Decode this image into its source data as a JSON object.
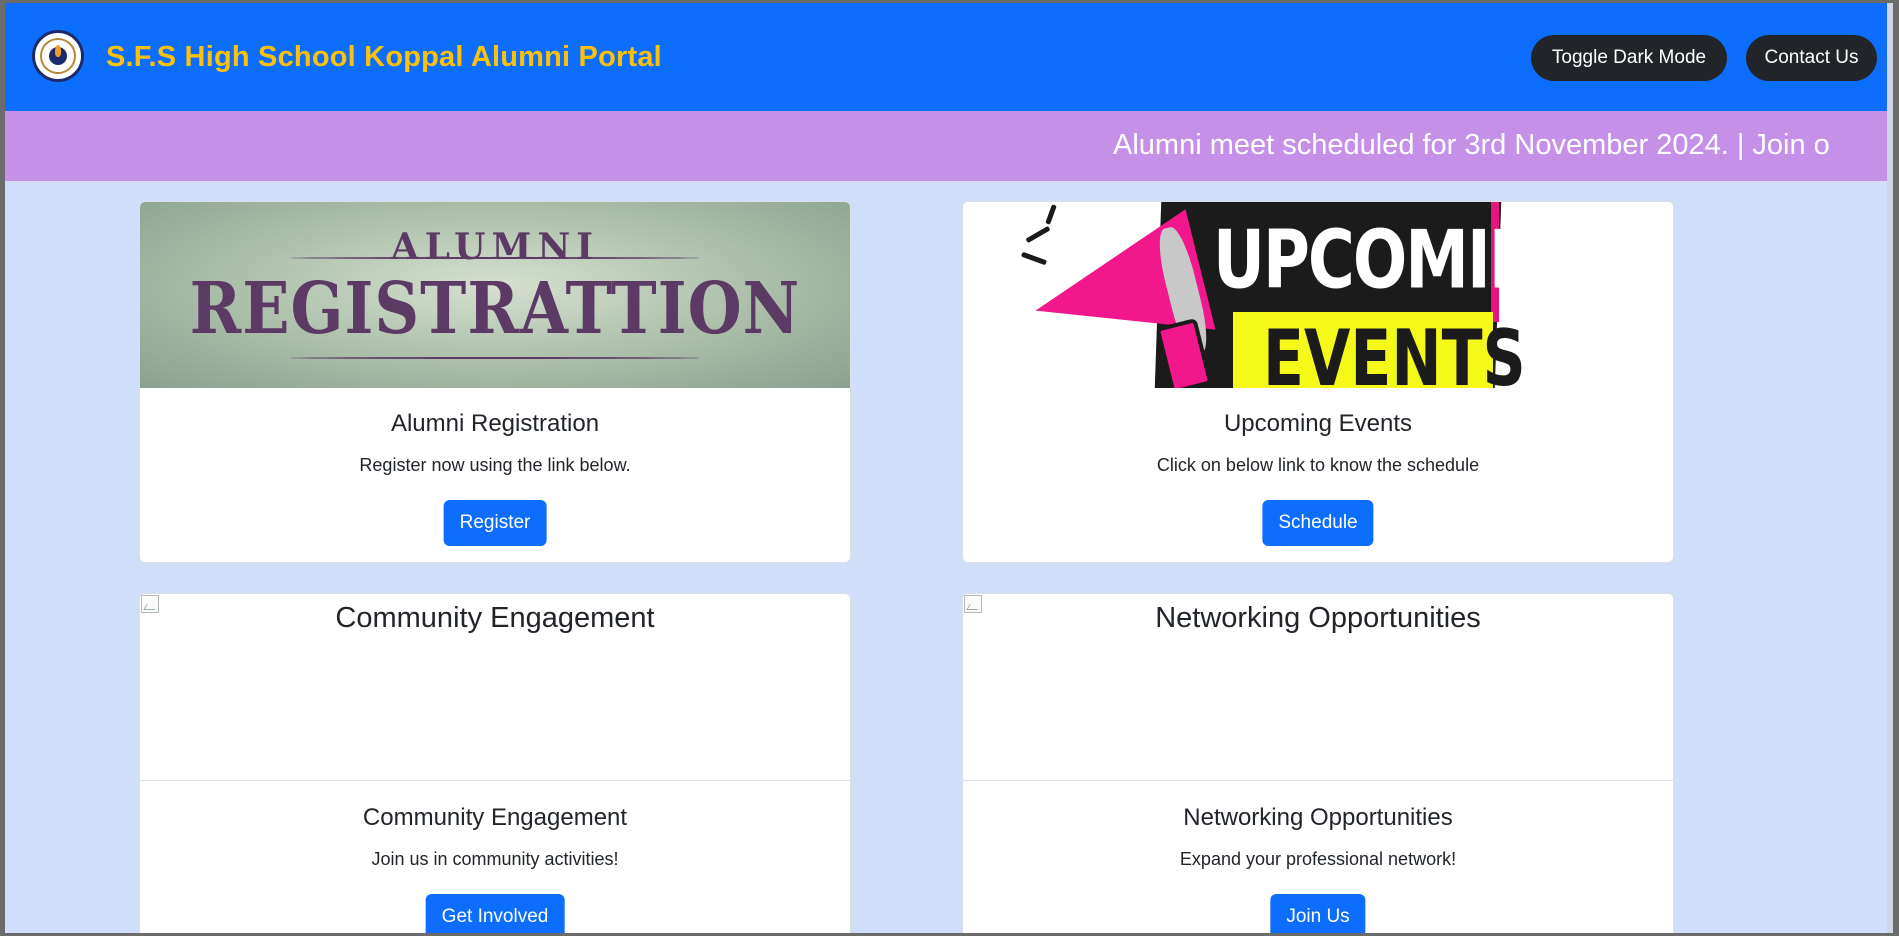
{
  "header": {
    "brand": "S.F.S High School Koppal Alumni Portal",
    "toggle_dark_mode": "Toggle Dark Mode",
    "contact_us": "Contact Us"
  },
  "ticker": {
    "text": "Alumni meet scheduled for 3rd November 2024. | Join o"
  },
  "cards": [
    {
      "image_line1": "ALUMNI",
      "image_line2": "REGISTRATTION",
      "title": "Alumni Registration",
      "text": "Register now using the link below.",
      "button": "Register"
    },
    {
      "image_line1": "UPCOMING",
      "image_line2": "EVENTS",
      "title": "Upcoming Events",
      "text": "Click on below link to know the schedule",
      "button": "Schedule"
    },
    {
      "image_alt": "Community Engagement",
      "title": "Community Engagement",
      "text": "Join us in community activities!",
      "button": "Get Involved"
    },
    {
      "image_alt": "Networking Opportunities",
      "title": "Networking Opportunities",
      "text": "Expand your professional network!",
      "button": "Join Us"
    }
  ],
  "colors": {
    "navbar": "#0d6efd",
    "brand_text": "#ffc107",
    "ticker_bg": "#c690e8",
    "page_bg": "#d0defa",
    "primary_button": "#0d6efd",
    "dark_button": "#212529"
  }
}
